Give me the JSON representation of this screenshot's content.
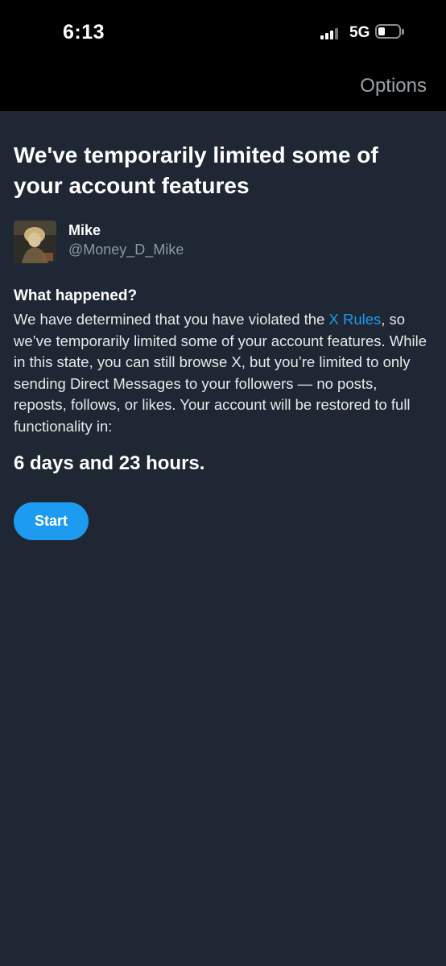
{
  "status_bar": {
    "time": "6:13",
    "network": "5G"
  },
  "nav": {
    "options_label": "Options"
  },
  "notice": {
    "headline": "We've temporarily limited some of your account features",
    "user": {
      "name": "Mike",
      "handle": "@Money_D_Mike"
    },
    "section_title": "What happened?",
    "body_before_link": "We have determined that you have violated the ",
    "link_text": "X Rules",
    "body_after_link": ", so we’ve temporarily limited some of your account features. While in this state, you can still browse X, but you’re limited to only sending Direct Messages to your followers — no posts, reposts, follows, or likes. Your account will be restored to full functionality in:",
    "duration": "6 days and 23 hours.",
    "start_label": "Start"
  },
  "colors": {
    "background": "#1e2733",
    "accent": "#1d9bf0",
    "secondary_text": "#8b98a5"
  },
  "icons": {
    "signal": "cellular-signal-icon",
    "battery": "battery-low-icon"
  }
}
